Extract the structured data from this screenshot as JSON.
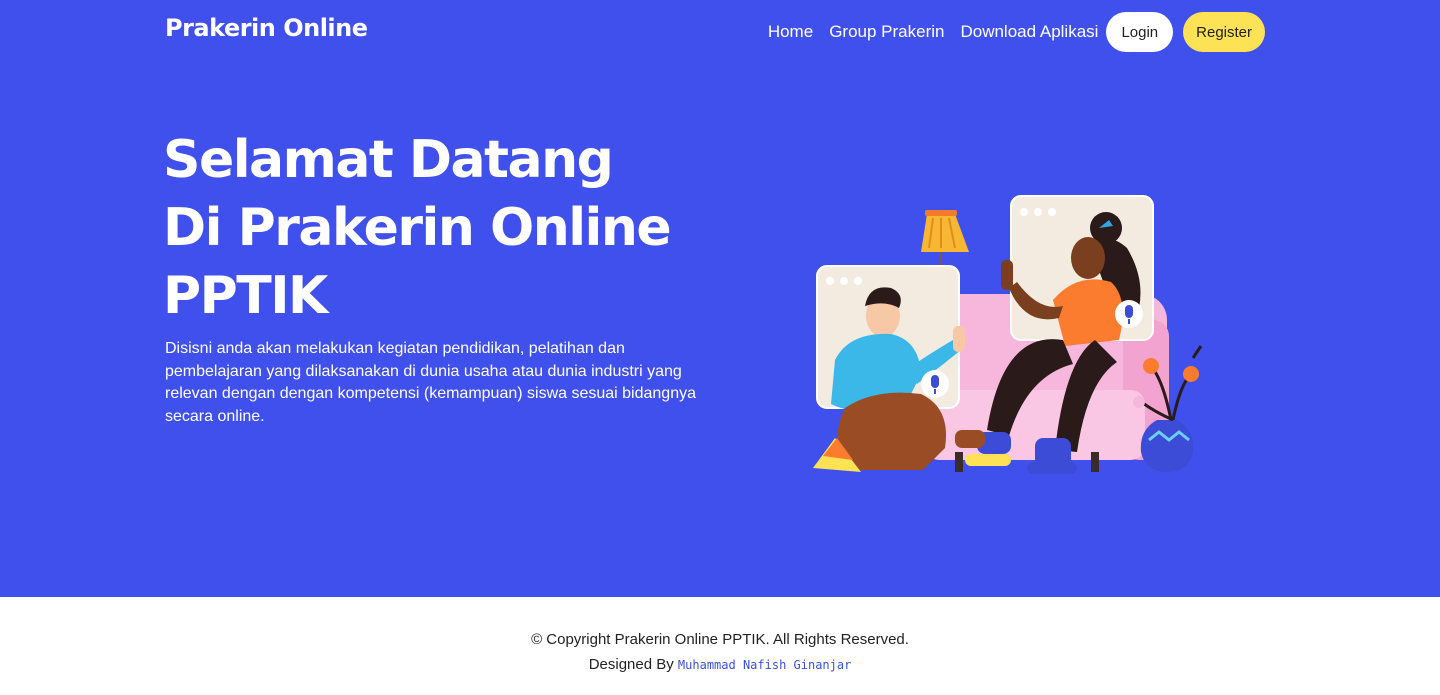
{
  "header": {
    "brand": "Prakerin Online",
    "nav": {
      "home": "Home",
      "group": "Group Prakerin",
      "download": "Download Aplikasi",
      "login": "Login",
      "register": "Register"
    }
  },
  "hero": {
    "title_line1": "Selamat Datang",
    "title_line2": "Di Prakerin Online",
    "title_line3": "PPTIK",
    "description": "Disisni anda akan melakukan kegiatan pendidikan, pelatihan dan pembelajaran yang dilaksanakan di dunia usaha atau dunia industri yang relevan dengan dengan kompetensi (kemampuan) siswa sesuai bidangnya secara online.",
    "illustration": "video-call-illustration"
  },
  "footer": {
    "copyright": "© Copyright Prakerin Online PPTIK. All Rights Reserved.",
    "designed_by": "Designed By",
    "designer": "Muhammad Nafish Ginanjar"
  },
  "colors": {
    "hero_bg": "#4050ec",
    "register_bg": "#fde256",
    "login_bg": "#ffffff",
    "designer_link": "#3b4fd6"
  }
}
